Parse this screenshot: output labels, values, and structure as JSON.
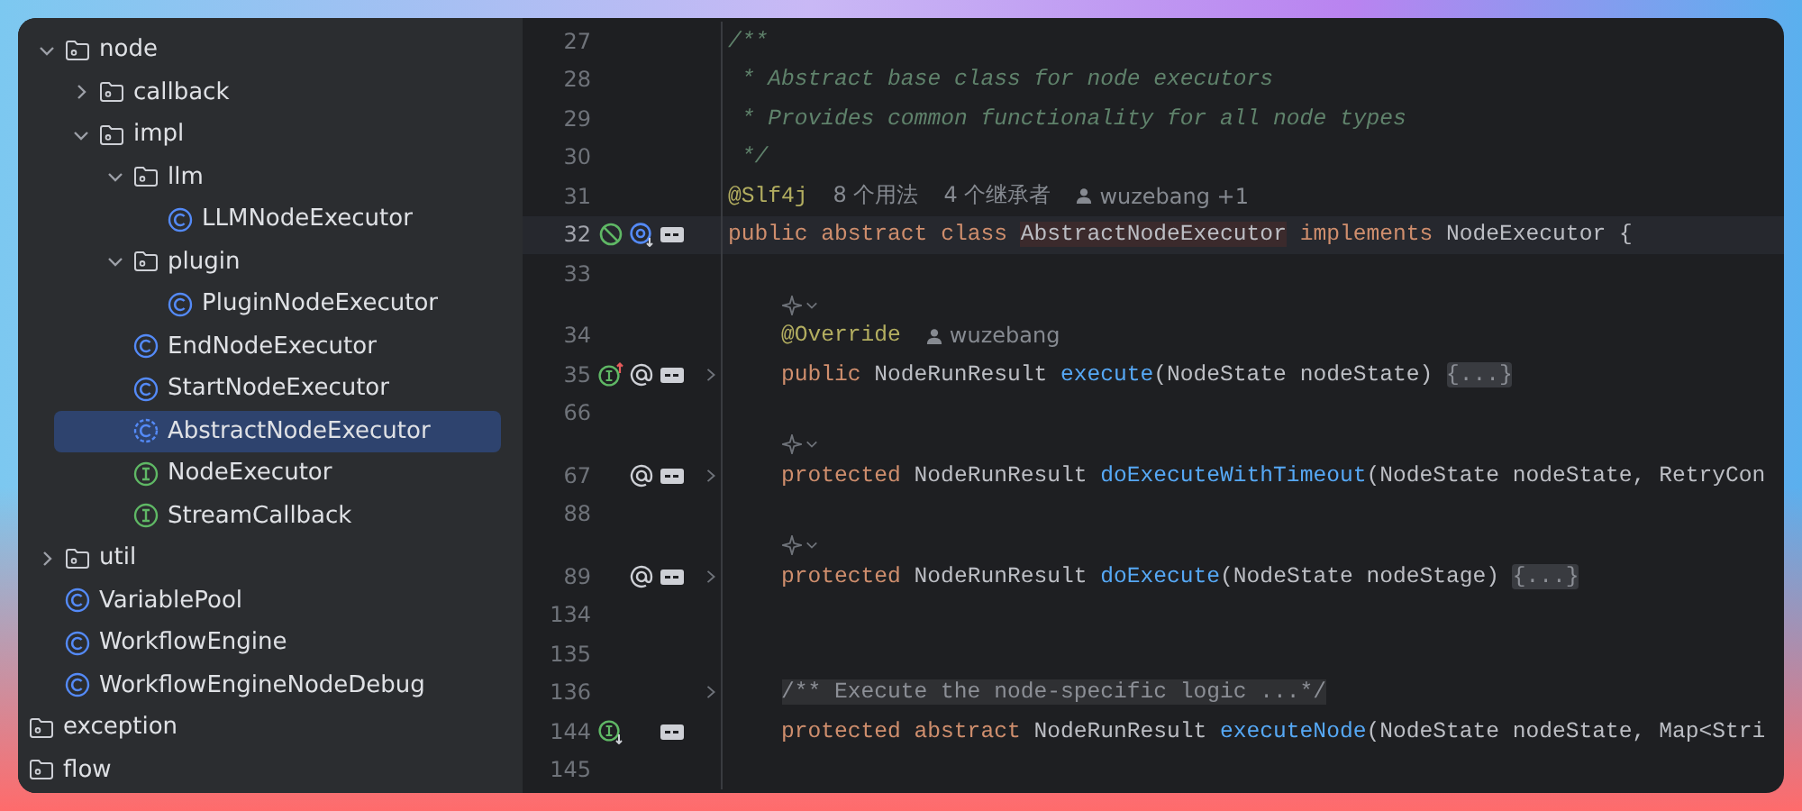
{
  "tree": [
    {
      "kind": "folder",
      "label": "node",
      "expanded": true,
      "selected": false,
      "children": [
        {
          "kind": "folder",
          "label": "callback",
          "expanded": false,
          "selected": false
        },
        {
          "kind": "folder",
          "label": "impl",
          "expanded": true,
          "selected": false,
          "children": [
            {
              "kind": "folder",
              "label": "llm",
              "expanded": true,
              "selected": false,
              "children": [
                {
                  "kind": "class",
                  "label": "LLMNodeExecutor",
                  "selected": false
                }
              ]
            },
            {
              "kind": "folder",
              "label": "plugin",
              "expanded": true,
              "selected": false,
              "children": [
                {
                  "kind": "class",
                  "label": "PluginNodeExecutor",
                  "selected": false
                }
              ]
            },
            {
              "kind": "class",
              "label": "EndNodeExecutor",
              "selected": false
            },
            {
              "kind": "class",
              "label": "StartNodeExecutor",
              "selected": false
            },
            {
              "kind": "abstract-class",
              "label": "AbstractNodeExecutor",
              "selected": true
            },
            {
              "kind": "interface",
              "label": "NodeExecutor",
              "selected": false
            },
            {
              "kind": "interface",
              "label": "StreamCallback",
              "selected": false
            }
          ]
        }
      ]
    },
    {
      "kind": "folder",
      "label": "util",
      "expanded": false,
      "selected": false
    },
    {
      "kind": "class",
      "label": "VariablePool",
      "selected": false
    },
    {
      "kind": "class",
      "label": "WorkflowEngine",
      "selected": false
    },
    {
      "kind": "class",
      "label": "WorkflowEngineNodeDebug",
      "selected": false
    },
    {
      "kind": "folder",
      "label": "exception",
      "selected": false
    },
    {
      "kind": "folder",
      "label": "flow",
      "selected": false
    }
  ],
  "editor": {
    "lines": [
      {
        "kind": "code",
        "number": "27",
        "current": false,
        "indented": false,
        "foldable": false,
        "tokens": [
          {
            "kind": "comment",
            "text": "/**"
          }
        ]
      },
      {
        "kind": "code",
        "number": "28",
        "current": false,
        "indented": false,
        "foldable": false,
        "tokens": [
          {
            "kind": "comment",
            "text": " * Abstract base class for node executors"
          }
        ]
      },
      {
        "kind": "code",
        "number": "29",
        "current": false,
        "indented": false,
        "foldable": false,
        "tokens": [
          {
            "kind": "comment",
            "text": " * Provides common functionality for all node types"
          }
        ]
      },
      {
        "kind": "code",
        "number": "30",
        "current": false,
        "indented": false,
        "foldable": false,
        "tokens": [
          {
            "kind": "comment",
            "text": " */"
          }
        ]
      },
      {
        "kind": "code",
        "number": "31",
        "current": false,
        "indented": false,
        "foldable": false,
        "tokens": [
          {
            "kind": "annotation",
            "text": "@Slf4j"
          },
          {
            "kind": "hint",
            "text": "8 个用法"
          },
          {
            "kind": "hint",
            "text": "4 个继承者"
          },
          {
            "kind": "author",
            "text": "wuzebang +1"
          }
        ]
      },
      {
        "kind": "code",
        "number": "32",
        "current": true,
        "indented": false,
        "foldable": false,
        "markers": [
          {
            "kind": "no-entry"
          },
          {
            "kind": "implemented"
          },
          {
            "kind": "doc"
          }
        ],
        "tokens": [
          {
            "kind": "keyword",
            "text": "public abstract class "
          },
          {
            "kind": "declaration",
            "text": "AbstractNodeExecutor"
          },
          {
            "kind": "keyword",
            "text": " implements"
          },
          {
            "kind": "plain",
            "text": " NodeExecutor {"
          }
        ]
      },
      {
        "kind": "code",
        "number": "33",
        "current": false,
        "foldable": false
      },
      {
        "kind": "hint",
        "current": false,
        "indented": true
      },
      {
        "kind": "code",
        "number": "34",
        "current": false,
        "indented": true,
        "foldable": false,
        "tokens": [
          {
            "kind": "annotation",
            "text": "@Override"
          },
          {
            "kind": "author",
            "text": "wuzebang"
          }
        ]
      },
      {
        "kind": "code",
        "number": "35",
        "current": false,
        "indented": true,
        "foldable": true,
        "markers": [
          {
            "kind": "overrides"
          },
          {
            "kind": "annotated"
          },
          {
            "kind": "doc"
          }
        ],
        "tokens": [
          {
            "kind": "keyword",
            "text": "public"
          },
          {
            "kind": "plain",
            "text": " NodeRunResult "
          },
          {
            "kind": "method",
            "text": "execute"
          },
          {
            "kind": "plain",
            "text": "(NodeState nodeState) "
          },
          {
            "kind": "folded",
            "text": "{...}"
          }
        ]
      },
      {
        "kind": "code",
        "number": "66",
        "current": false,
        "foldable": false
      },
      {
        "kind": "hint",
        "current": false,
        "indented": true
      },
      {
        "kind": "code",
        "number": "67",
        "current": false,
        "indented": true,
        "foldable": true,
        "markers": [
          {
            "kind": "annotated"
          },
          {
            "kind": "doc"
          }
        ],
        "tokens": [
          {
            "kind": "keyword",
            "text": "protected"
          },
          {
            "kind": "plain",
            "text": " NodeRunResult "
          },
          {
            "kind": "method",
            "text": "doExecuteWithTimeout"
          },
          {
            "kind": "plain",
            "text": "(NodeState nodeState, RetryCon"
          }
        ]
      },
      {
        "kind": "code",
        "number": "88",
        "current": false,
        "foldable": false
      },
      {
        "kind": "hint",
        "current": false,
        "indented": true
      },
      {
        "kind": "code",
        "number": "89",
        "current": false,
        "indented": true,
        "foldable": true,
        "markers": [
          {
            "kind": "annotated"
          },
          {
            "kind": "doc"
          }
        ],
        "tokens": [
          {
            "kind": "keyword",
            "text": "protected"
          },
          {
            "kind": "plain",
            "text": " NodeRunResult "
          },
          {
            "kind": "method",
            "text": "doExecute"
          },
          {
            "kind": "plain",
            "text": "(NodeState nodeStage) "
          },
          {
            "kind": "folded",
            "text": "{...}"
          }
        ]
      },
      {
        "kind": "code",
        "number": "134",
        "current": false,
        "foldable": false
      },
      {
        "kind": "code",
        "number": "135",
        "current": false,
        "foldable": false
      },
      {
        "kind": "code",
        "number": "136",
        "current": false,
        "indented": true,
        "foldable": true,
        "tokens": [
          {
            "kind": "folded-comment",
            "text": "/** Execute the node-specific logic ...*/"
          }
        ]
      },
      {
        "kind": "code",
        "number": "144",
        "current": false,
        "indented": true,
        "foldable": false,
        "markers": [
          {
            "kind": "implemented-interface"
          },
          {
            "kind": "doc"
          }
        ],
        "tokens": [
          {
            "kind": "keyword",
            "text": "protected abstract"
          },
          {
            "kind": "plain",
            "text": " NodeRunResult "
          },
          {
            "kind": "method",
            "text": "executeNode"
          },
          {
            "kind": "plain",
            "text": "(NodeState nodeState, Map<Stri"
          }
        ]
      },
      {
        "kind": "code",
        "number": "145",
        "current": false,
        "foldable": false
      }
    ]
  }
}
